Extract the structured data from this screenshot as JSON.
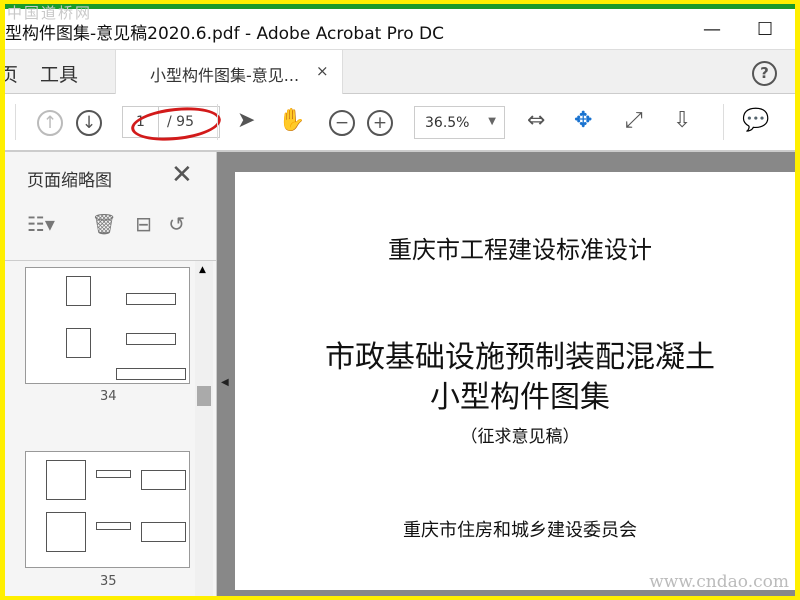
{
  "watermark_top": "中国道桥网",
  "watermark_bottom": "www.cndao.com",
  "window": {
    "title": "型构件图集-意见稿2020.6.pdf - Adobe Acrobat Pro DC",
    "minimize": "—",
    "maximize": "☐"
  },
  "tabs": {
    "home": "页",
    "tools": "工具",
    "doc": "小型构件图集-意见...",
    "close": "×",
    "help": "?"
  },
  "toolbar": {
    "page_current": "1",
    "page_total": "/ 95",
    "zoom": "36.5%"
  },
  "sidebar": {
    "title": "页面缩略图",
    "close": "✕",
    "thumbnails": [
      {
        "label": "34"
      },
      {
        "label": "35"
      }
    ]
  },
  "document": {
    "line1": "重庆市工程建设标准设计",
    "line2": "市政基础设施预制装配混凝土",
    "line3": "小型构件图集",
    "line4": "（征求意见稿）",
    "line5": "重庆市住房和城乡建设委员会"
  },
  "colors": {
    "accent": "#1a73d0",
    "annotation": "#d21a1a",
    "frame": "#ffef00"
  }
}
